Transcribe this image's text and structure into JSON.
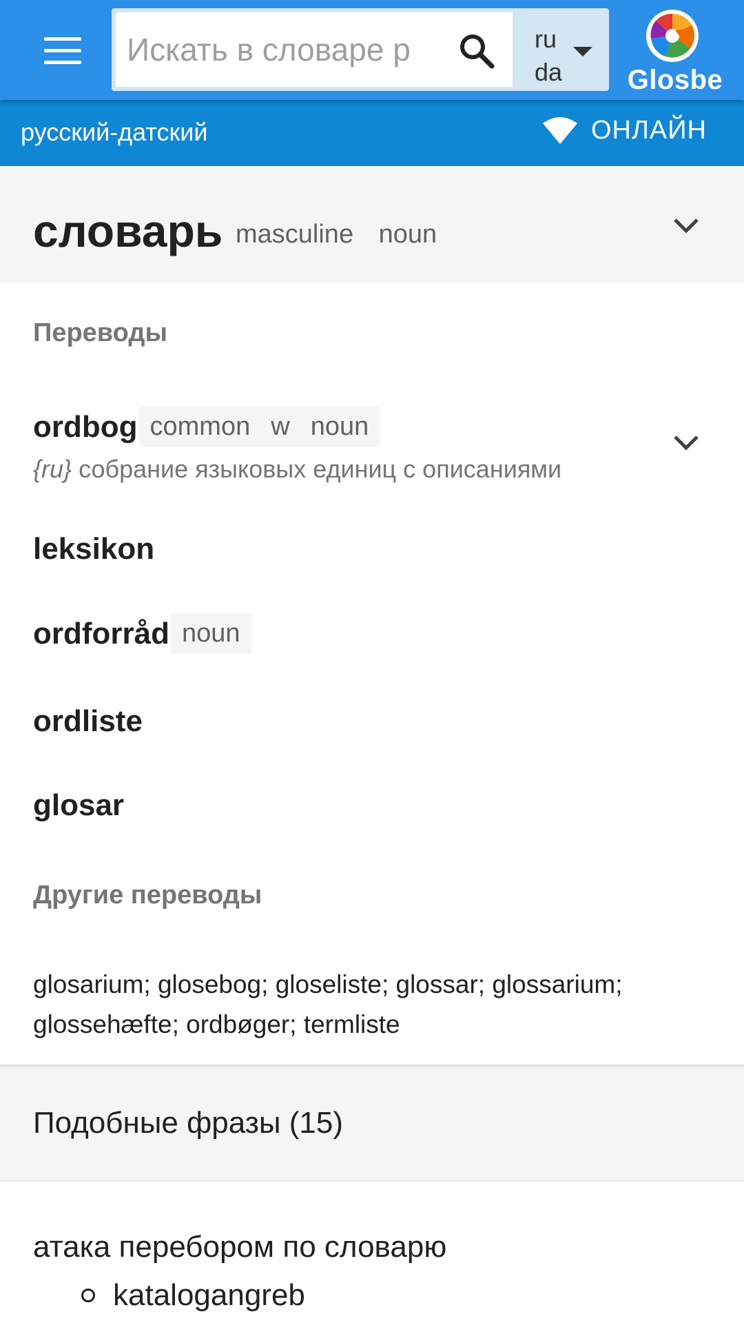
{
  "header": {
    "search_placeholder": "Искать в словаре р",
    "lang_from": "ru",
    "lang_to": "da",
    "brand": "Glosbe",
    "accent_color": "#2c8fe8"
  },
  "subbar": {
    "pair": "русский-датский",
    "status": "ОНЛАЙН"
  },
  "headword": {
    "word": "словарь",
    "gender": "masculine",
    "pos": "noun"
  },
  "translations": {
    "label": "Переводы",
    "items": [
      {
        "word": "ordbog",
        "tags": [
          "common",
          "w",
          "noun"
        ],
        "desc_lang": "{ru}",
        "desc": " собрание языковых единиц с описаниями"
      },
      {
        "word": "leksikon"
      },
      {
        "word": "ordforråd",
        "tags": [
          "noun"
        ]
      },
      {
        "word": "ordliste"
      },
      {
        "word": "glosar"
      }
    ]
  },
  "other": {
    "label": "Другие переводы",
    "text": "glosarium; glosebog; gloseliste; glossar; glossarium; glossehæfte; ordbøger; termliste"
  },
  "similar": {
    "label": "Подобные фразы (15)",
    "phrase": "атака перебором по словарю",
    "translation": "katalogangreb"
  }
}
